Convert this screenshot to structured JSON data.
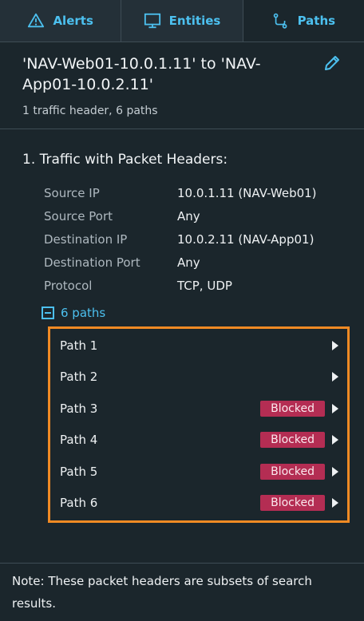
{
  "tabs": [
    {
      "label": "Alerts",
      "icon": "warning-icon"
    },
    {
      "label": "Entities",
      "icon": "monitor-icon"
    },
    {
      "label": "Paths",
      "icon": "path-icon",
      "active": true
    }
  ],
  "header": {
    "title": "'NAV-Web01-10.0.1.11' to 'NAV-App01-10.0.2.11'",
    "summary": "1 traffic header, 6 paths"
  },
  "section": {
    "title": "1. Traffic with Packet Headers:",
    "properties": [
      {
        "label": "Source IP",
        "value": "10.0.1.11 (NAV-Web01)"
      },
      {
        "label": "Source Port",
        "value": "Any"
      },
      {
        "label": "Destination IP",
        "value": "10.0.2.11 (NAV-App01)"
      },
      {
        "label": "Destination Port",
        "value": "Any"
      },
      {
        "label": "Protocol",
        "value": "TCP, UDP"
      }
    ]
  },
  "paths": {
    "toggle_label": "6 paths",
    "items": [
      {
        "label": "Path 1",
        "badge": ""
      },
      {
        "label": "Path 2",
        "badge": ""
      },
      {
        "label": "Path 3",
        "badge": "Blocked"
      },
      {
        "label": "Path 4",
        "badge": "Blocked"
      },
      {
        "label": "Path 5",
        "badge": "Blocked"
      },
      {
        "label": "Path 6",
        "badge": "Blocked"
      }
    ]
  },
  "note": "Note: These packet headers are subsets of search results.",
  "colors": {
    "accent": "#4cc0ef",
    "blocked": "#b42d53",
    "highlight_border": "#f08a24"
  }
}
